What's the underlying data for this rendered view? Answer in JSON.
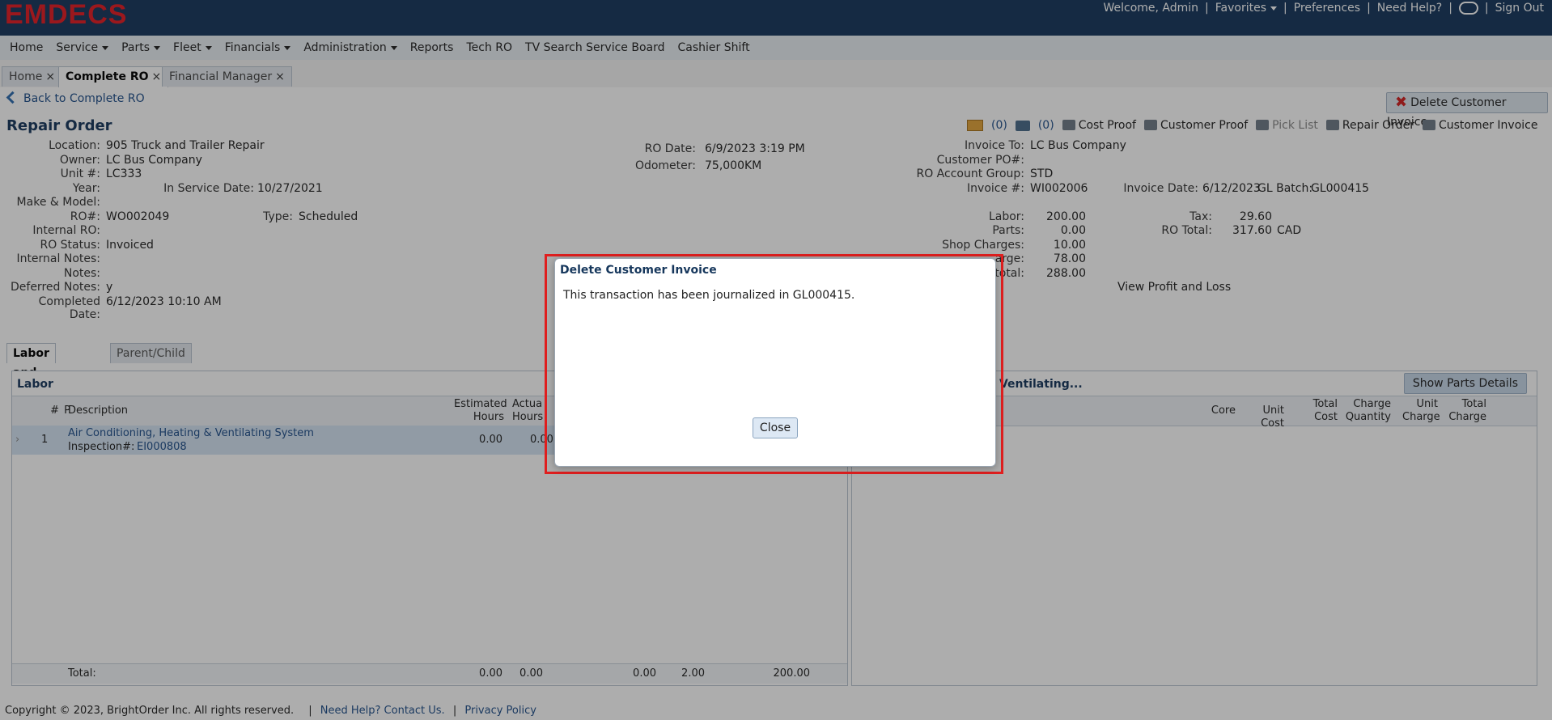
{
  "brand": {
    "logo": "EMDECS",
    "logo_color": "#e31b23",
    "bar_color": "#16375c"
  },
  "top_links": {
    "welcome": "Welcome, Admin",
    "favorites": "Favorites",
    "preferences": "Preferences",
    "help": "Need Help?",
    "sign_out": "Sign Out"
  },
  "nav": [
    "Home",
    "Service",
    "Parts",
    "Fleet",
    "Financials",
    "Administration",
    "Reports",
    "Tech RO",
    "TV Search Service Board",
    "Cashier Shift"
  ],
  "tabs": [
    {
      "label": "Home"
    },
    {
      "label": "Complete RO",
      "active": true
    },
    {
      "label": "Financial Manager"
    }
  ],
  "back_label": "Back to Complete RO",
  "delete_button": "Delete Customer Invoice",
  "title": "Repair Order",
  "actions": {
    "mail_count": "(0)",
    "photo_count": "(0)",
    "cost_proof": "Cost Proof",
    "customer_proof": "Customer Proof",
    "pick_list": "Pick List",
    "repair_order": "Repair Order",
    "customer_invoice": "Customer Invoice"
  },
  "left": {
    "location_l": "Location:",
    "location": "905 Truck and Trailer Repair",
    "owner_l": "Owner:",
    "owner": "LC Bus Company",
    "unit_l": "Unit #:",
    "unit": "LC333",
    "year_l": "Year:",
    "service_date_l": "In Service Date:",
    "service_date": "10/27/2021",
    "make_l": "Make & Model:",
    "ro_l": "RO#:",
    "ro": "WO002049",
    "type_l": "Type:",
    "type": "Scheduled",
    "internal_ro_l": "Internal RO:",
    "status_l": "RO Status:",
    "status": "Invoiced",
    "internal_notes_l": "Internal Notes:",
    "notes_l": "Notes:",
    "deferred_l": "Deferred Notes:",
    "deferred": "y",
    "completed_l": "Completed Date:",
    "completed": "6/12/2023 10:10 AM"
  },
  "middle": {
    "ro_date_l": "RO Date:",
    "ro_date": "6/9/2023 3:19 PM",
    "odometer_l": "Odometer:",
    "odometer": "75,000",
    "odometer_unit": "KM"
  },
  "right": {
    "invoice_to_l": "Invoice To:",
    "invoice_to": "LC Bus Company",
    "customer_po_l": "Customer PO#:",
    "account_group_l": "RO Account Group:",
    "account_group": "STD",
    "invoice_no_l": "Invoice #:",
    "invoice_no": "WI002006",
    "invoice_date_l": "Invoice Date:",
    "invoice_date": "6/12/2023",
    "gl_batch_l": "GL Batch:",
    "gl_batch": "GL000415",
    "labor_l": "Labor:",
    "labor": "200.00",
    "parts_l": "Parts:",
    "parts": "0.00",
    "shop_l": "Shop Charges:",
    "shop": "10.00",
    "charge_l": "arge:",
    "charge": "78.00",
    "subtotal_l": "total:",
    "subtotal": "288.00",
    "tax_l": "Tax:",
    "tax": "29.60",
    "ro_total_l": "RO Total:",
    "ro_total": "317.60",
    "currency": "CAD",
    "profit_loss": "View Profit and Loss"
  },
  "lower_tabs": {
    "labor_parts": "Labor and Parts",
    "parent_child": "Parent/Child"
  },
  "labor": {
    "title": "Labor",
    "headers": {
      "num": "#",
      "p": "P",
      "description": "Description",
      "est": "Estimated Hours",
      "actual": "Actual Hours"
    },
    "row": {
      "num": "1",
      "description": "Air Conditioning, Heating & Ventilating System",
      "inspection_label": "Inspection#:",
      "inspection": "EI000808",
      "est": "0.00",
      "actual": "0.00"
    },
    "total": {
      "label": "Total:",
      "v1": "0.00",
      "v2": "0.00",
      "v3": "0.00",
      "v4": "2.00",
      "v5": "200.00"
    }
  },
  "parts": {
    "title": "g & Ventilating...",
    "show_details": "Show Parts Details",
    "headers": {
      "core": "Core",
      "unit_cost": "Unit Cost",
      "total_cost": "Total Cost",
      "charge_qty": "Charge Quantity",
      "unit_charge": "Unit Charge",
      "total_charge": "Total Charge"
    }
  },
  "footer": {
    "copyright": "Copyright © 2023, BrightOrder Inc. All rights reserved.",
    "help": "Need Help? Contact Us.",
    "privacy": "Privacy Policy"
  },
  "dialog": {
    "title": "Delete Customer Invoice",
    "message": "This transaction has been journalized in GL000415.",
    "close": "Close"
  }
}
